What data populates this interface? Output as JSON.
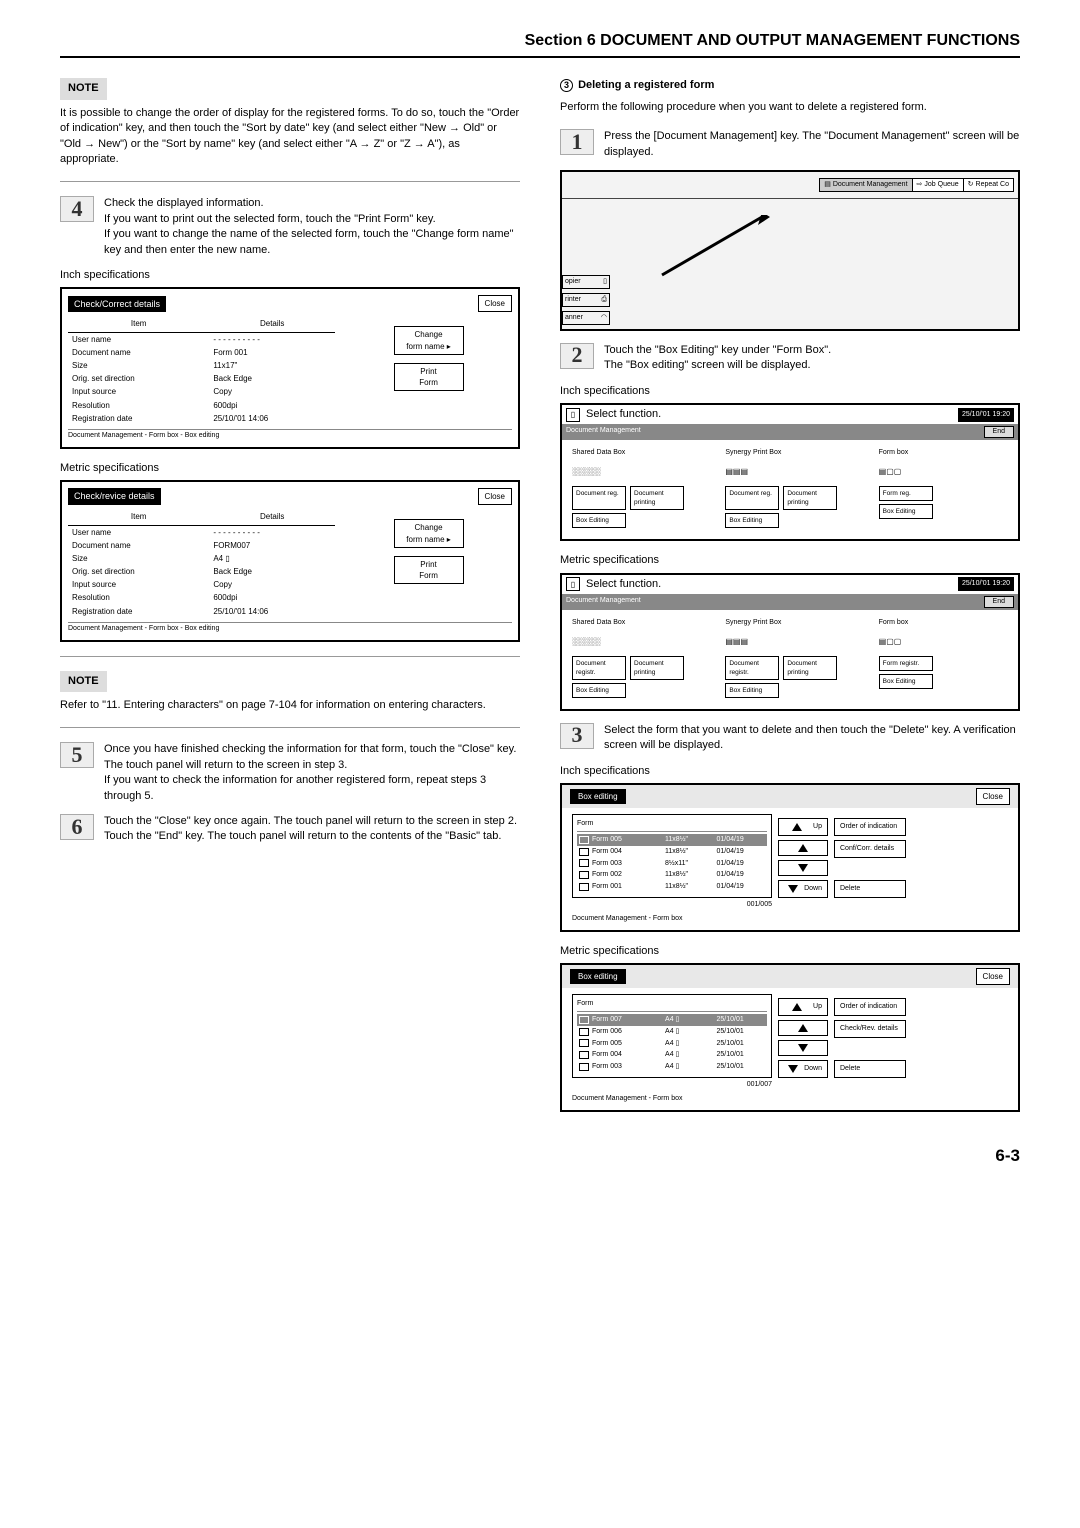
{
  "section_title": "Section 6  DOCUMENT AND OUTPUT MANAGEMENT FUNCTIONS",
  "page_num": "6-3",
  "left": {
    "note_label": "NOTE",
    "note1": "It is possible to change the order of display for the registered forms. To do so, touch the \"Order of indication\" key, and then touch the \"Sort by date\" key (and select either \"New → Old\" or \"Old → New\") or the \"Sort by name\" key (and select either \"A → Z\" or \"Z → A\"), as appropriate.",
    "step4_num": "4",
    "step4": "Check the displayed information.\nIf you want to print out the selected form, touch the \"Print Form\" key.\nIf you want to change the name of the selected form, touch the \"Change form name\" key and then enter the new name.",
    "inch_label": "Inch specifications",
    "metric_label": "Metric specifications",
    "panel_inch": {
      "title": "Check/Correct details",
      "close": "Close",
      "item_h": "Item",
      "det_h": "Details",
      "rows": [
        [
          "User name",
          "- - - - - - - - - -"
        ],
        [
          "Document name",
          "Form 001"
        ],
        [
          "Size",
          "11x17\""
        ],
        [
          "Orig. set direction",
          "Back Edge"
        ],
        [
          "Input source",
          "Copy"
        ],
        [
          "Resolution",
          "600dpi"
        ],
        [
          "Registration date",
          "25/10/'01 14:06"
        ]
      ],
      "btn1a": "Change",
      "btn1b": "form name",
      "btn2a": "Print",
      "btn2b": "Form",
      "crumb": "Document Management - Form box - Box editing"
    },
    "panel_metric": {
      "title": "Check/revice details",
      "close": "Close",
      "item_h": "Item",
      "det_h": "Details",
      "rows": [
        [
          "User name",
          "- - - - - - - - - -"
        ],
        [
          "Document name",
          "FORM007"
        ],
        [
          "Size",
          "A4 ▯"
        ],
        [
          "Orig. set direction",
          "Back Edge"
        ],
        [
          "Input source",
          "Copy"
        ],
        [
          "Resolution",
          "600dpi"
        ],
        [
          "Registration date",
          "25/10/'01 14:06"
        ]
      ],
      "btn1a": "Change",
      "btn1b": "form name",
      "btn2a": "Print",
      "btn2b": "Form",
      "crumb": "Document Management - Form box - Box editing"
    },
    "note2": "Refer to \"11. Entering characters\" on page 7-104 for information on entering characters.",
    "step5_num": "5",
    "step5": "Once you have finished checking the information for that form, touch the \"Close\" key. The touch panel will return to the screen in step 3.\nIf you want to check the information for another registered form, repeat steps 3 through 5.",
    "step6_num": "6",
    "step6": "Touch the \"Close\" key once again. The touch panel will return to the screen in step 2.\nTouch the \"End\" key. The touch panel will return to the contents of the \"Basic\" tab."
  },
  "right": {
    "sub_num": "3",
    "sub_title": "Deleting a registered form",
    "intro": "Perform the following procedure when you want to delete a registered form.",
    "step1_num": "1",
    "step1": "Press the [Document Management] key. The \"Document Management\" screen will be displayed.",
    "top_tabs": {
      "a": "Document Management",
      "b": "Job Queue",
      "c": "Repeat Co"
    },
    "side_tabs": {
      "a": "opier",
      "b": "rinter",
      "c": "anner"
    },
    "step2_num": "2",
    "step2": "Touch the \"Box Editing\" key under \"Form Box\".\nThe \"Box editing\" screen will be displayed.",
    "sel_title": "Select function.",
    "ts1": "25/10/'01 19:20",
    "ts2": "25/10/'01   19:20",
    "docmgmt": "Document Management",
    "end": "End",
    "cols_inch": {
      "c1": "Shared Data Box",
      "c2": "Synergy Print Box",
      "c3": "Form box",
      "r1a": "Document reg.",
      "r1b": "Document printing",
      "r2a": "Document reg.",
      "r2b": "Document printing",
      "r3": "Form reg.",
      "be": "Box Editing"
    },
    "cols_metric": {
      "c1": "Shared Data Box",
      "c2": "Synergy Print Box",
      "c3": "Form box",
      "r1a": "Document registr.",
      "r1b": "Document printing",
      "r2a": "Document registr.",
      "r2b": "Document printing",
      "r3": "Form registr.",
      "be": "Box Editing"
    },
    "step3_num": "3",
    "step3": "Select the form that you want to delete and then touch the \"Delete\" key. A verification screen will be displayed.",
    "box_inch": {
      "title": "Box editing",
      "close": "Close",
      "head": "Form",
      "rows": [
        [
          "Form 005",
          "11x8½\"",
          "01/04/19"
        ],
        [
          "Form 004",
          "11x8½\"",
          "01/04/19"
        ],
        [
          "Form 003",
          "8½x11\"",
          "01/04/19"
        ],
        [
          "Form 002",
          "11x8½\"",
          "01/04/19"
        ],
        [
          "Form 001",
          "11x8½\"",
          "01/04/19"
        ]
      ],
      "count": "001/005",
      "up": "Up",
      "dn": "Down",
      "b1": "Order of indication",
      "b2": "Conf/Corr. details",
      "b3": "Delete",
      "crumb": "Document Management - Form box"
    },
    "box_metric": {
      "title": "Box editing",
      "close": "Close",
      "head": "Form",
      "rows": [
        [
          "Form 007",
          "A4 ▯",
          "25/10/01"
        ],
        [
          "Form 006",
          "A4 ▯",
          "25/10/01"
        ],
        [
          "Form 005",
          "A4 ▯",
          "25/10/01"
        ],
        [
          "Form 004",
          "A4 ▯",
          "25/10/01"
        ],
        [
          "Form 003",
          "A4 ▯",
          "25/10/01"
        ]
      ],
      "count": "001/007",
      "up": "Up",
      "dn": "Down",
      "b1": "Order of indication",
      "b2": "Check/Rev. details",
      "b3": "Delete",
      "crumb": "Document Management - Form box"
    }
  }
}
